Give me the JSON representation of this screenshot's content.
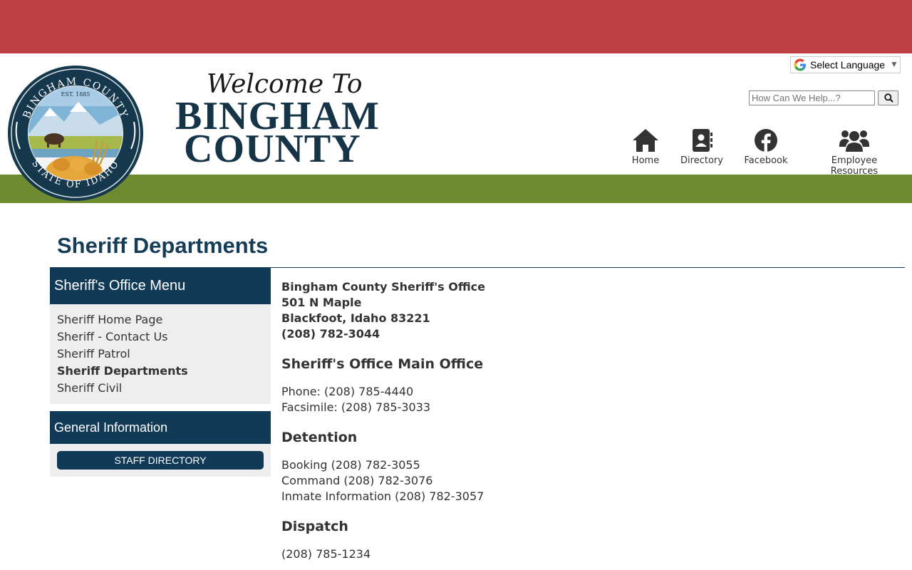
{
  "header": {
    "welcome": "Welcome To",
    "county_line1": "Bingham",
    "county_line2": "County",
    "seal": {
      "top_text": "BINGHAM COUNTY",
      "est": "EST. 1885",
      "bottom_text": "STATE OF IDAHO"
    }
  },
  "translate": {
    "label": "Select Language",
    "arrow": "▼"
  },
  "search": {
    "placeholder": "How Can We Help...?"
  },
  "nav": [
    {
      "label": "Home",
      "icon": "home-icon"
    },
    {
      "label": "Directory",
      "icon": "contact-book-icon"
    },
    {
      "label": "Facebook",
      "icon": "facebook-icon"
    },
    {
      "label": "Employee Resources",
      "icon": "users-icon"
    }
  ],
  "page": {
    "title": "Sheriff Departments"
  },
  "sidebar": {
    "menu_title": "Sheriff's Office Menu",
    "items": [
      {
        "label": "Sheriff Home Page"
      },
      {
        "label": "Sheriff - Contact Us"
      },
      {
        "label": "Sheriff Patrol"
      },
      {
        "label": "Sheriff Departments"
      },
      {
        "label": "Sheriff Civil"
      }
    ],
    "info_title": "General Information",
    "staff_button": "STAFF DIRECTORY"
  },
  "content": {
    "address": [
      "Bingham County Sheriff's Office",
      "501 N Maple",
      "Blackfoot, Idaho 83221",
      "(208) 782-3044"
    ],
    "main_office": {
      "heading": "Sheriff's Office Main Office",
      "lines": [
        "Phone: (208) 785-4440",
        "Facsimile: (208) 785-3033"
      ]
    },
    "detention": {
      "heading": "Detention",
      "lines": [
        "Booking (208) 782-3055",
        "Command (208) 782-3076",
        "Inmate Information (208) 782-3057"
      ]
    },
    "dispatch": {
      "heading": "Dispatch",
      "lines": [
        "(208) 785-1234"
      ]
    }
  },
  "colors": {
    "top_band": "#bf4042",
    "green_band": "#6e8b2f",
    "navy": "#113a57",
    "title": "#163d58"
  }
}
